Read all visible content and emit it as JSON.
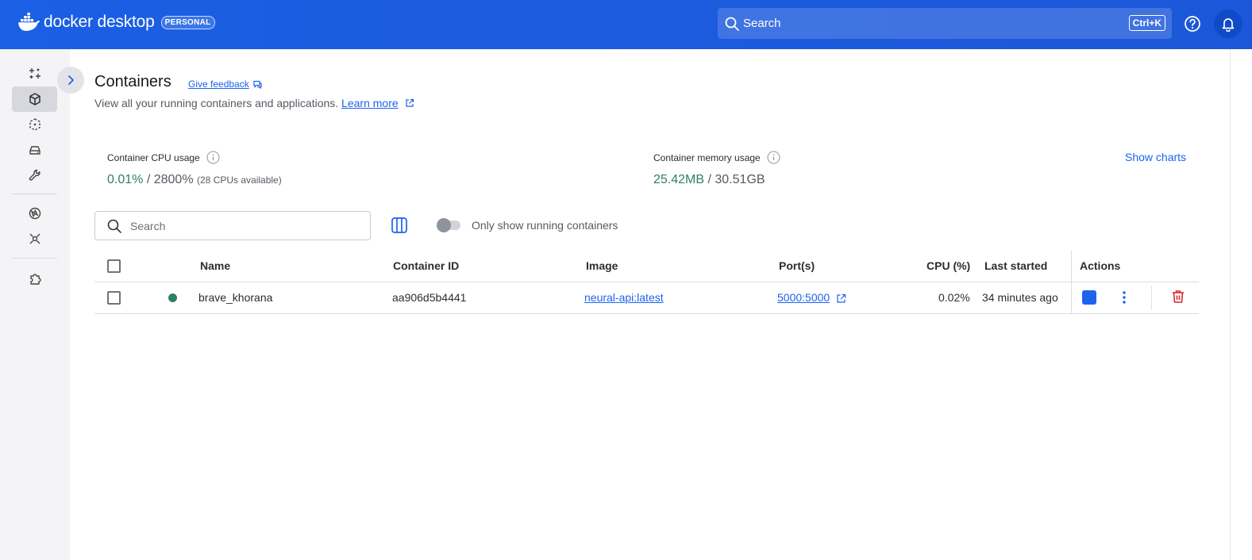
{
  "app": {
    "brand_word": "docker desktop",
    "plan_badge": "PERSONAL",
    "search_placeholder": "Search",
    "search_shortcut": "Ctrl+K",
    "colors": {
      "topbar": "#1d63ed",
      "accent": "#1d63ed",
      "running": "#2f7f68",
      "danger": "#d32f2f"
    }
  },
  "sidebar": {
    "items": [
      {
        "icon": "sparkle-icon",
        "active": false
      },
      {
        "icon": "containers-icon",
        "active": true
      },
      {
        "icon": "images-icon",
        "active": false
      },
      {
        "icon": "volumes-icon",
        "active": false
      },
      {
        "icon": "builds-icon",
        "active": false
      },
      {
        "icon": "docker-scout-icon",
        "active": false
      },
      {
        "icon": "models-icon",
        "active": false
      },
      {
        "icon": "extensions-icon",
        "active": false
      }
    ]
  },
  "header": {
    "title": "Containers",
    "feedback": "Give feedback",
    "subtitle": "View all your running containers and applications.",
    "learn_more": "Learn more"
  },
  "stats": {
    "cpu_label": "Container CPU usage",
    "cpu_used": "0.01%",
    "cpu_sep": "/",
    "cpu_total": "2800%",
    "cpu_note": "(28 CPUs available)",
    "mem_label": "Container memory usage",
    "mem_used": "25.42MB",
    "mem_sep": "/",
    "mem_total": "30.51GB",
    "show_charts": "Show charts"
  },
  "toolbar": {
    "search_placeholder": "Search",
    "only_running_label": "Only show running containers",
    "only_running": false
  },
  "table": {
    "columns": [
      "Name",
      "Container ID",
      "Image",
      "Port(s)",
      "CPU (%)",
      "Last started",
      "Actions"
    ],
    "rows": [
      {
        "status": "running",
        "name": "brave_khorana",
        "container_id": "aa906d5b4441",
        "image": "neural-api:latest",
        "ports": "5000:5000",
        "cpu": "0.02%",
        "last_started": "34 minutes ago"
      }
    ]
  }
}
